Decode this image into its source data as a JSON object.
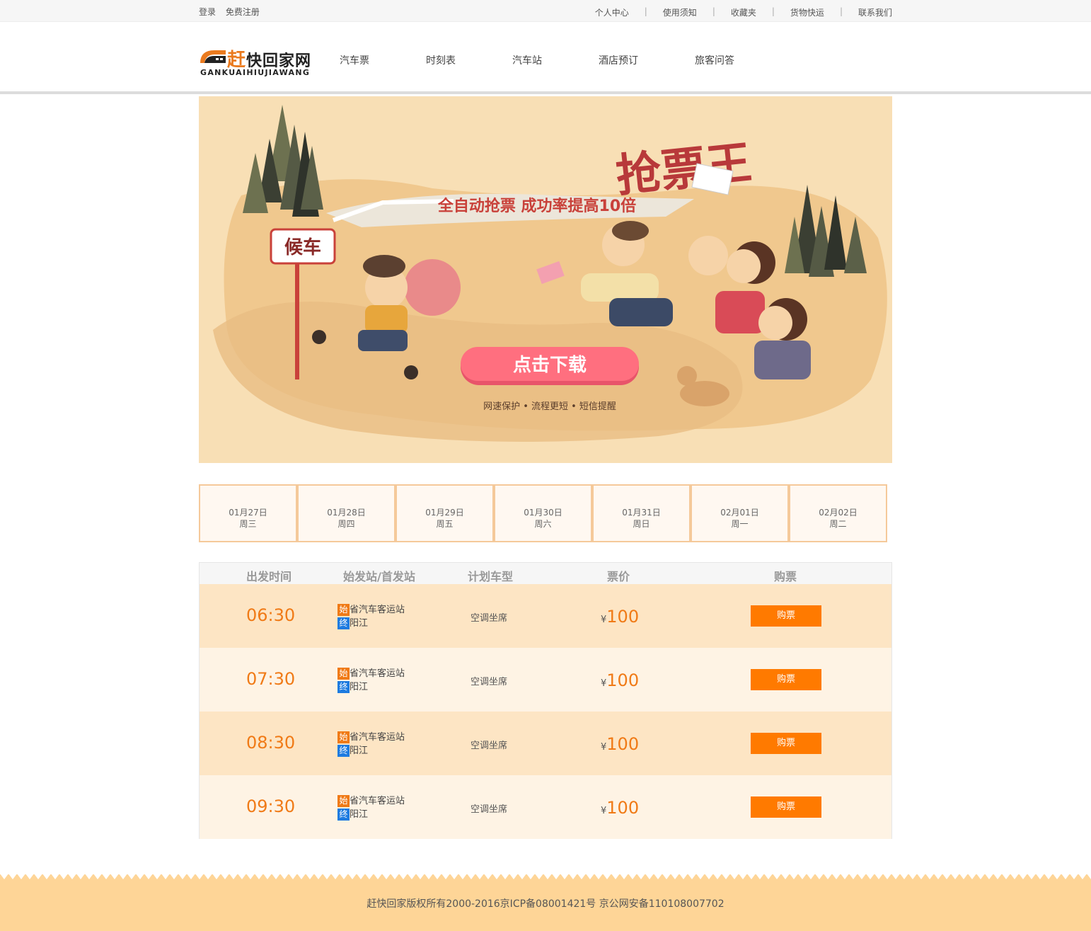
{
  "topbar": {
    "login": "登录",
    "register": "免费注册",
    "links": [
      "个人中心",
      "使用须知",
      "收藏夹",
      "货物快运",
      "联系我们"
    ],
    "separator": "|"
  },
  "logo": {
    "brand_first": "赶",
    "brand_rest": "快回家网",
    "pinyin": "GANKUAIHIUJIAWANG"
  },
  "nav": [
    "汽车票",
    "时刻表",
    "汽车站",
    "酒店预订",
    "旅客问答"
  ],
  "banner": {
    "wait_sign": "候车",
    "title": "抢票王",
    "slogan": "全自动抢票  成功率提高10倍",
    "download_button": "点击下载",
    "features": "网速保护  •  流程更短  •  短信提醒"
  },
  "dates": [
    {
      "date": "01月27日",
      "weekday": "周三"
    },
    {
      "date": "01月28日",
      "weekday": "周四"
    },
    {
      "date": "01月29日",
      "weekday": "周五"
    },
    {
      "date": "01月30日",
      "weekday": "周六"
    },
    {
      "date": "01月31日",
      "weekday": "周日"
    },
    {
      "date": "02月01日",
      "weekday": "周一"
    },
    {
      "date": "02月02日",
      "weekday": "周二"
    }
  ],
  "table": {
    "headers": [
      "出发时间",
      "始发站/首发站",
      "计划车型",
      "票价",
      "购票"
    ],
    "start_tag": "始",
    "end_tag": "终",
    "currency": "¥",
    "rows": [
      {
        "time": "06:30",
        "from": "省汽车客运站",
        "to": "阳江",
        "type": "空调坐席",
        "price": "100",
        "button": "购票"
      },
      {
        "time": "07:30",
        "from": "省汽车客运站",
        "to": "阳江",
        "type": "空调坐席",
        "price": "100",
        "button": "购票"
      },
      {
        "time": "08:30",
        "from": "省汽车客运站",
        "to": "阳江",
        "type": "空调坐席",
        "price": "100",
        "button": "购票"
      },
      {
        "time": "09:30",
        "from": "省汽车客运站",
        "to": "阳江",
        "type": "空调坐席",
        "price": "100",
        "button": "购票"
      }
    ]
  },
  "footer": {
    "copyright": "赶快回家版权所有2000-2016京ICP备08001421号  京公网安备110108007702"
  },
  "colors": {
    "accent": "#f07a16",
    "button": "#ff7a00",
    "end_tag": "#1e7be0",
    "banner_bg": "#f8dfb5",
    "footer_bg": "#fed597"
  }
}
